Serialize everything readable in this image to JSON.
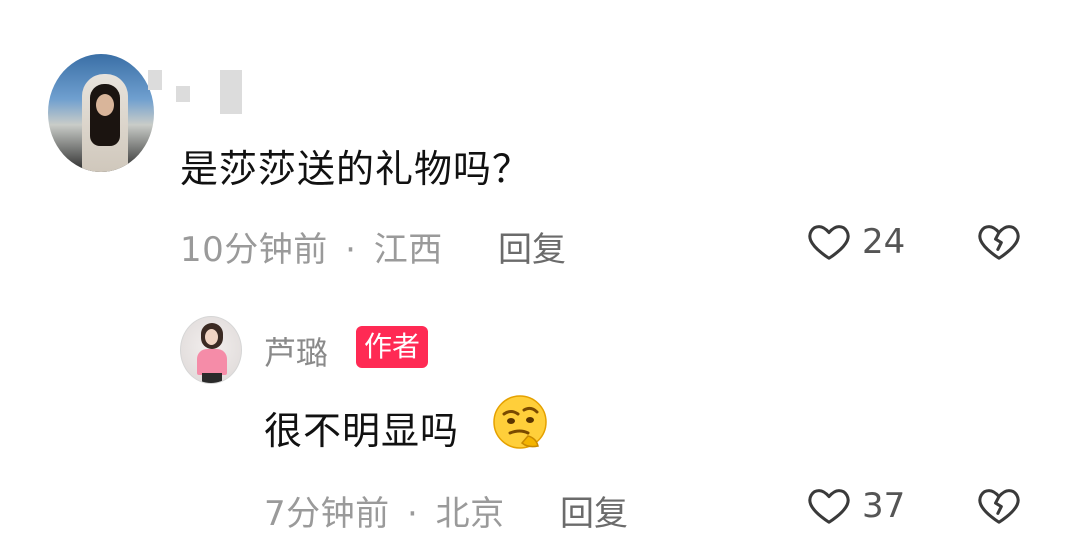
{
  "comment1": {
    "text": "是莎莎送的礼物吗？",
    "time": "10分钟前",
    "separator": "·",
    "location": "江西",
    "reply_label": "回复",
    "likes": "24",
    "icons": {
      "like": "heart-outline-icon",
      "dislike": "broken-heart-icon"
    }
  },
  "comment2": {
    "author": "芦璐",
    "author_badge": "作者",
    "text": "很不明显吗",
    "emoji": "thinking-smirk-emoji",
    "time": "7分钟前",
    "separator": "·",
    "location": "北京",
    "reply_label": "回复",
    "likes": "37"
  },
  "colors": {
    "badge_bg": "#ff2a54",
    "meta_text": "#9a9a9a",
    "icon_stroke": "#3a3a3a"
  }
}
